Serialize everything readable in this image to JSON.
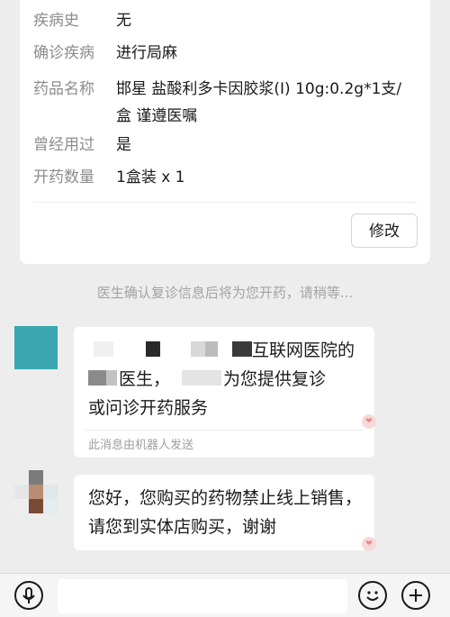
{
  "prescription": {
    "rows": [
      {
        "label": "疾病史",
        "value": "无"
      },
      {
        "label": "确诊疾病",
        "value": "进行局麻"
      },
      {
        "label": "药品名称",
        "value": "邯星 盐酸利多卡因胶浆(I) 10g:0.2g*1支/盒 谨遵医嘱"
      },
      {
        "label": "曾经用过",
        "value": "是"
      },
      {
        "label": "开药数量",
        "value": "1盒装 x 1"
      }
    ],
    "edit_button": "修改"
  },
  "system_note": "医生确认复诊信息后将为您开药，请稍等...",
  "messages": [
    {
      "text_line1": "互联网医院的",
      "text_line2": "医生，",
      "text_line2b": "为您提供复诊",
      "text_line3": "或问诊开药服务",
      "footer": "此消息由机器人发送"
    },
    {
      "text": "您好，您购买的药物禁止线上销售，请您到实体店购买，谢谢"
    }
  ],
  "colors": {
    "background": "#ededed",
    "avatar_teal": "#3aa6b0",
    "label_gray": "#8c8c8c"
  },
  "icons": [
    "voice-icon",
    "emoji-icon",
    "plus-icon"
  ]
}
